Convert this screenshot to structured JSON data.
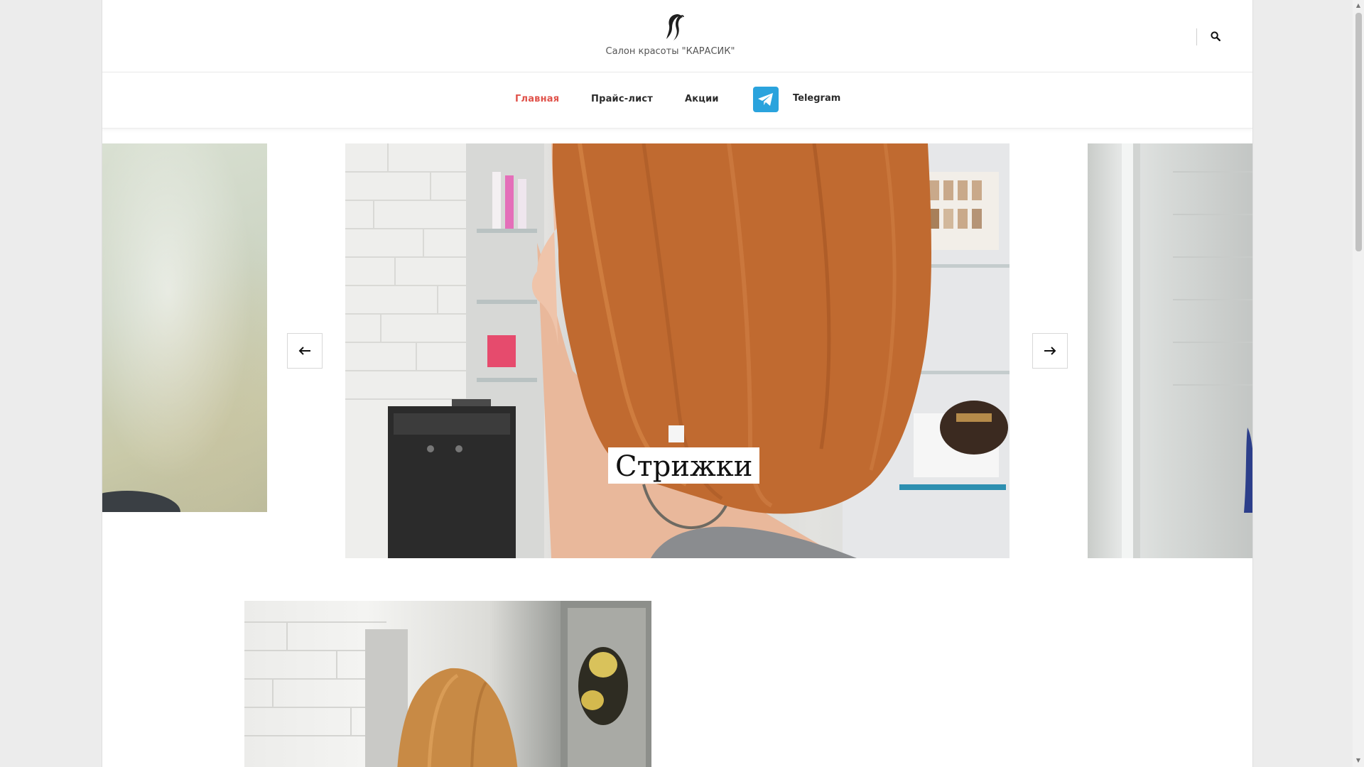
{
  "header": {
    "site_title": "Салон красоты \"КАРАСИК\"",
    "logo_icon": "hair-silhouette-icon",
    "search_icon": "search-icon"
  },
  "nav": {
    "items": [
      {
        "label": "Главная",
        "active": true
      },
      {
        "label": "Прайс-лист",
        "active": false
      },
      {
        "label": "Акции",
        "active": false
      }
    ],
    "telegram": {
      "label": "Telegram",
      "icon": "telegram-icon"
    }
  },
  "slider": {
    "caption": "Стрижки",
    "prev_icon": "arrow-left-icon",
    "next_icon": "arrow-right-icon"
  },
  "colors": {
    "accent": "#e0524a",
    "telegram": "#2aa3dd",
    "hair": "#c2662a"
  }
}
